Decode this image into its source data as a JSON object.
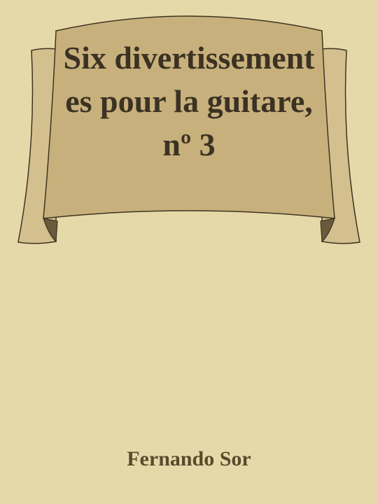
{
  "book": {
    "title": "Six divertissementes pour la guitare, nº 3",
    "author": "Fernando Sor"
  },
  "colors": {
    "background": "#e6d9a9",
    "banner_fill": "#c8b07c",
    "banner_side": "#d4c08f",
    "banner_fold": "#6a5a3c",
    "banner_outline": "#3f3422",
    "title_text": "#3b3223",
    "author_text": "#5a4a2c"
  }
}
